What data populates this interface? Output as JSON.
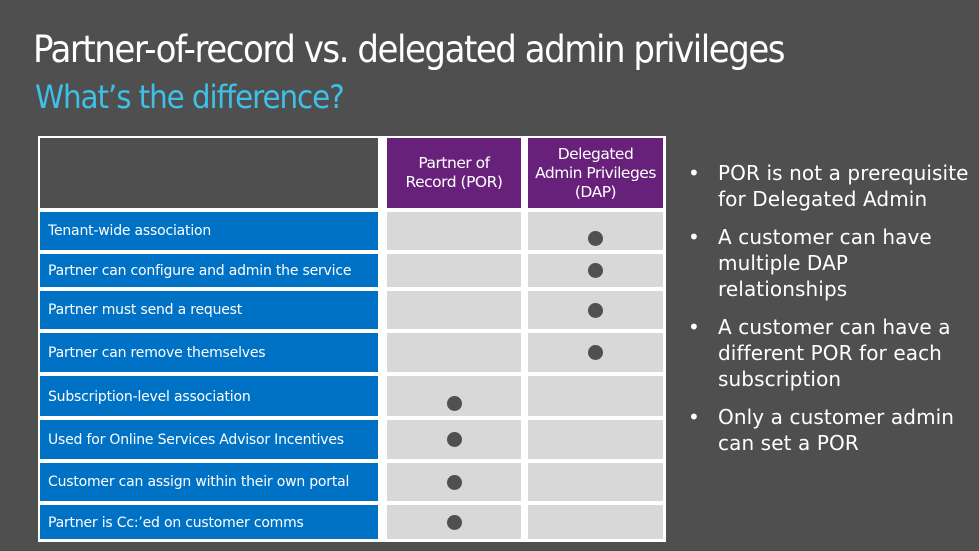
{
  "slide": {
    "title": "Partner-of-record vs. delegated admin privileges",
    "subtitle": "What’s the difference?"
  },
  "table": {
    "columns": [
      "",
      "Partner of Record (POR)",
      "Delegated Admin Privileges (DAP)"
    ],
    "header_por_lines": [
      "Partner of",
      "Record (POR)"
    ],
    "header_dap_lines": [
      "Delegated",
      "Admin Privileges",
      "(DAP)"
    ],
    "rows": [
      {
        "label": "Tenant-wide association",
        "por": false,
        "dap": true
      },
      {
        "label": "Partner can configure and admin the service",
        "por": false,
        "dap": true
      },
      {
        "label": "Partner must send a request",
        "por": false,
        "dap": true
      },
      {
        "label": "Partner can remove themselves",
        "por": false,
        "dap": true
      },
      {
        "label": "Subscription-level association",
        "por": true,
        "dap": false
      },
      {
        "label": "Used for Online Services Advisor Incentives",
        "por": true,
        "dap": false
      },
      {
        "label": "Customer can assign within their own portal",
        "por": true,
        "dap": false
      },
      {
        "label": "Partner is Cc:’ed on customer comms",
        "por": true,
        "dap": false
      }
    ]
  },
  "bullets": {
    "glyph": "•",
    "items": [
      "POR is not a prerequisite for Delegated Admin",
      "A customer can have multiple DAP relationships",
      "A customer can have a different POR for each subscription",
      "Only a customer admin can set a POR"
    ]
  },
  "colors": {
    "background": "#4f4f4f",
    "subtitle": "#3ec0e8",
    "header": "#68217a",
    "row_label": "#0072c6",
    "mark_cell": "#d8d8d8",
    "dot": "#505050"
  }
}
